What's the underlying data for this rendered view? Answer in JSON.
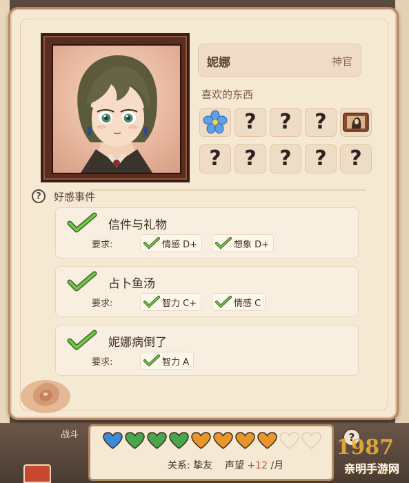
{
  "character": {
    "name": "妮娜",
    "role": "神官"
  },
  "likes": {
    "label": "喜欢的东西",
    "items": [
      {
        "icon": "blue-flower-icon",
        "known": true
      },
      {
        "icon": "question-icon",
        "text": "?",
        "known": false
      },
      {
        "icon": "question-icon",
        "text": "?",
        "known": false
      },
      {
        "icon": "question-icon",
        "text": "?",
        "known": false
      },
      {
        "icon": "painting-icon",
        "known": true
      },
      {
        "icon": "question-icon",
        "text": "?",
        "known": false
      },
      {
        "icon": "question-icon",
        "text": "?",
        "known": false
      },
      {
        "icon": "question-icon",
        "text": "?",
        "known": false
      },
      {
        "icon": "question-icon",
        "text": "?",
        "known": false
      },
      {
        "icon": "question-icon",
        "text": "?",
        "known": false
      }
    ]
  },
  "events": {
    "help": "?",
    "label": "好感事件",
    "req_label": "要求:",
    "items": [
      {
        "title": "信件与礼物",
        "requirements": [
          "情感 D+",
          "想象 D+"
        ]
      },
      {
        "title": "占卜鱼汤",
        "requirements": [
          "智力 C+",
          "情感 C"
        ]
      },
      {
        "title": "妮娜病倒了",
        "requirements": [
          "智力 A"
        ]
      }
    ]
  },
  "affection": {
    "hearts": [
      "blue",
      "green",
      "green",
      "green",
      "orange",
      "orange",
      "orange",
      "orange",
      "empty",
      "empty"
    ],
    "relation_label": "关系:",
    "relation_value": "挚友",
    "reputation_label": "声望",
    "reputation_value": "+12",
    "reputation_unit": "/月"
  },
  "help_bottom": "?",
  "background": {
    "battle_tab": "战斗"
  },
  "watermark": {
    "number": "1987",
    "text": "亲明手游网"
  },
  "colors": {
    "card_bg": "#f6e9d4",
    "card_border": "#b58763",
    "check_green": "#5aa838",
    "heart_blue": "#3d8ad6",
    "heart_green": "#4aa64a",
    "heart_orange": "#e8962c"
  }
}
